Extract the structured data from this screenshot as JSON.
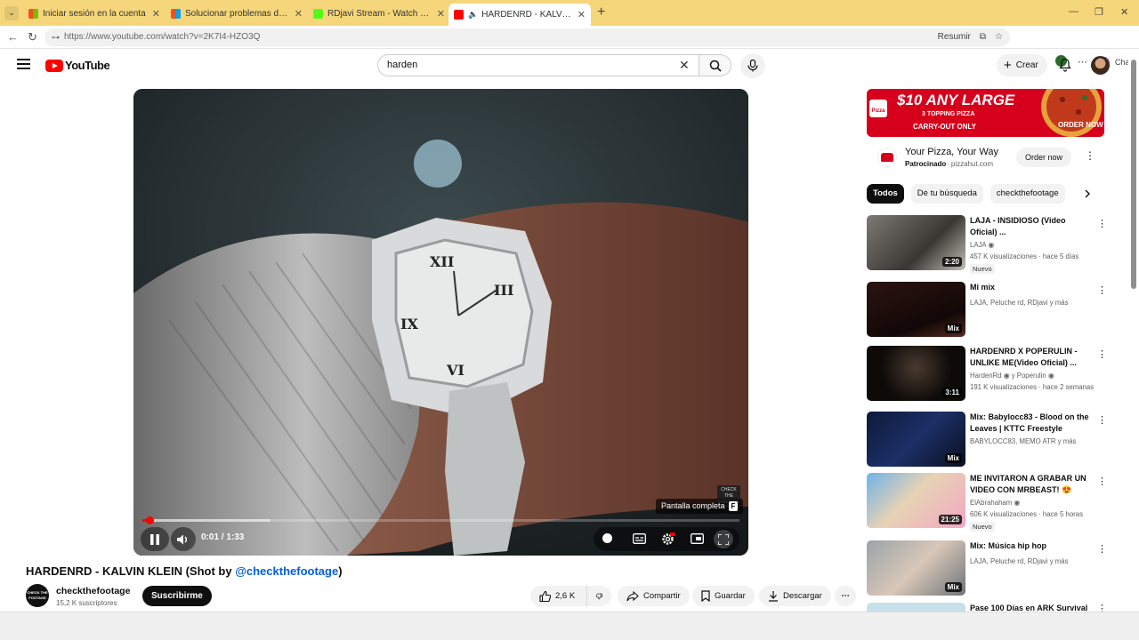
{
  "browser": {
    "tabs": [
      {
        "title": "Iniciar sesión en la cuenta"
      },
      {
        "title": "Solucionar problemas de Bluetooth"
      },
      {
        "title": "RDjavi Stream - Watch Live on Kick"
      },
      {
        "title": "HARDENRD - KALVIN KLEIN (Shot by"
      }
    ],
    "url": "https://www.youtube.com/watch?v=2K7I4-HZO3Q",
    "resume_label": "Resumir",
    "chat_label": "Chat"
  },
  "header": {
    "logo_text": "YouTube",
    "search_value": "harden",
    "create_label": "Crear"
  },
  "player": {
    "time": "0:01 / 1:33",
    "progress_fraction": 0.012,
    "fullscreen_tip": "Pantalla completa",
    "fullscreen_key": "F",
    "watermark": "CHECK THE FOOTAGE"
  },
  "video": {
    "title_main": "HARDENRD - KALVIN KLEIN (Shot by ",
    "title_link": "@checkthefootage",
    "title_end": ")",
    "channel_name": "checkthefootage",
    "channel_subs": "15,2 K suscriptores",
    "channel_avatar_text": "CHECK THE FOOTAGE",
    "subscribe_label": "Suscribirme",
    "likes": "2,6 K",
    "share_label": "Compartir",
    "save_label": "Guardar",
    "download_label": "Descargar"
  },
  "ad": {
    "banner_main": "$10 ANY LARGE",
    "banner_sub": "3 TOPPING PIZZA",
    "banner_sub2": "CARRY-OUT ONLY",
    "banner_cta": "ORDER NOW",
    "title": "Your Pizza, Your Way",
    "sponsored": "Patrocinado",
    "domain": "pizzahut.com",
    "button": "Order now"
  },
  "chips": [
    "Todos",
    "De tu búsqueda",
    "checkthefootage"
  ],
  "recommendations": [
    {
      "title": "LAJA - INSIDIOSO (Video Oficial) ...",
      "channel": "LAJA",
      "verified": true,
      "views": "457 K visualizaciones · hace 5 días",
      "duration": "2:20",
      "new": "Nuevo"
    },
    {
      "title": "Mi mix",
      "channel": "LAJA, Peluche rd, RDjavi y más",
      "verified": false,
      "views": "",
      "duration": "Mix",
      "new": ""
    },
    {
      "title": "HARDENRD X POPERULIN - UNLIKE ME(Video Oficial) ...",
      "channel": "HardenRd",
      "channel2": "y Poperulin",
      "verified": true,
      "views": "191 K visualizaciones · hace 2 semanas",
      "duration": "3:11",
      "new": ""
    },
    {
      "title": "Mix: Babylocc83 - Blood on the Leaves | KTTC Freestyle",
      "channel": "BABYLOCC83, MEMO ATR y más",
      "verified": false,
      "views": "",
      "duration": "Mix",
      "new": ""
    },
    {
      "title": "ME INVITARON A GRABAR UN VIDEO CON MRBEAST! 😍",
      "channel": "ElAbrahaham",
      "verified": true,
      "views": "606 K visualizaciones · hace 5 horas",
      "duration": "21:25",
      "new": "Nuevo"
    },
    {
      "title": "Mix: Música hip hop",
      "channel": "LAJA, Peluche rd, RDjavi y más",
      "verified": false,
      "views": "",
      "duration": "Mix",
      "new": ""
    },
    {
      "title": "Pase 100 Días en ARK Survival",
      "channel": "",
      "verified": false,
      "views": "",
      "duration": "",
      "new": ""
    }
  ],
  "colors": {
    "accent": "#ff0000",
    "link": "#065fd4",
    "tabbar": "#f5d67a"
  }
}
